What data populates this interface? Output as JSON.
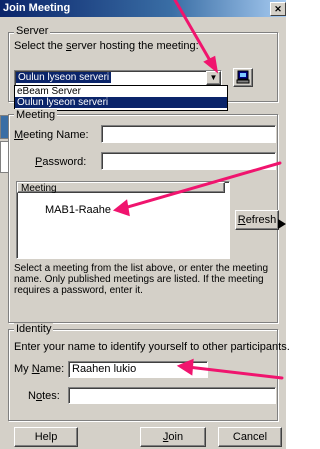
{
  "window": {
    "title": "Join Meeting"
  },
  "server_group": {
    "legend": "Server",
    "prompt_pre": "Select the ",
    "prompt_u": "s",
    "prompt_post": "erver hosting the meeting:",
    "selected": "Oulun lyseon serveri",
    "options": [
      "eBeam Server",
      "Oulun lyseon serveri"
    ]
  },
  "meeting_group": {
    "legend": "Meeting",
    "name_label_u": "M",
    "name_label_rest": "eeting Name:",
    "name_value": "",
    "password_label_u": "P",
    "password_label_rest": "assword:",
    "password_value": "",
    "list_header": "Meeting",
    "items": [
      "MAB1-Raahe"
    ],
    "refresh_u": "R",
    "refresh_rest": "efresh",
    "help_lines": [
      "Select a meeting from the list above, or enter the meeting",
      "name. Only published meetings are listed.  If the meeting",
      "requires a password, enter it."
    ]
  },
  "identity_group": {
    "legend": "Identity",
    "prompt": "Enter your name to identify yourself to other participants.",
    "name_label_pre": "My ",
    "name_label_u": "N",
    "name_label_post": "ame:",
    "name_value": "Raahen lukio",
    "notes_label_u": "o",
    "notes_label_pre": "N",
    "notes_label_post": "tes:",
    "notes_value": ""
  },
  "buttons": {
    "help": "Help",
    "join_u": "J",
    "join_rest": "oin",
    "cancel": "Cancel"
  },
  "colors": {
    "arrow": "#f0146e",
    "titlebar": "#0a246a",
    "face": "#d4d0c8"
  }
}
